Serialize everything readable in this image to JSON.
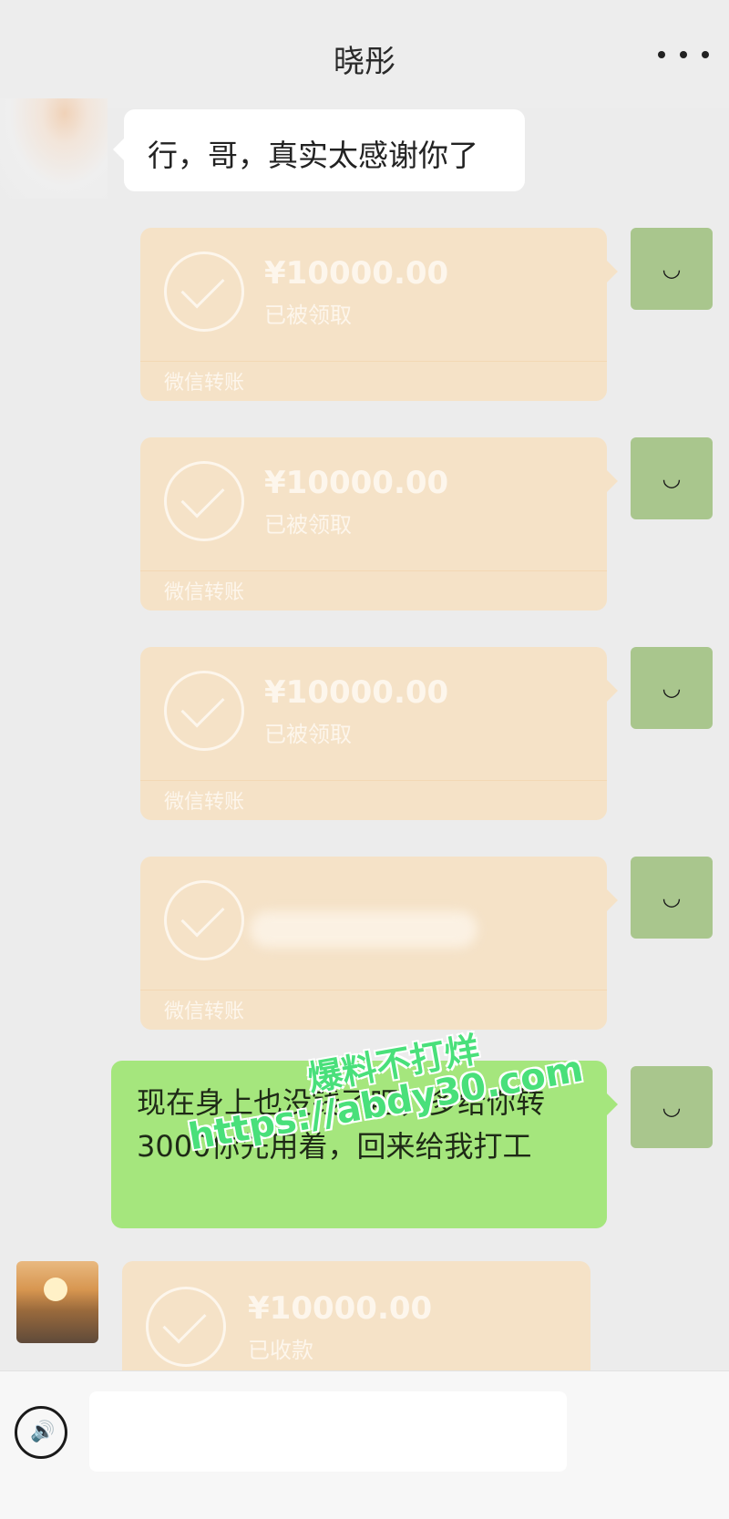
{
  "header": {
    "title": "晓彤",
    "more_icon": "ellipsis-icon"
  },
  "messages": {
    "incoming_text": "行，哥，真实太感谢你了",
    "transfers": [
      {
        "amount": "¥10000.00",
        "status": "已被领取",
        "brand": "微信转账"
      },
      {
        "amount": "¥10000.00",
        "status": "已被领取",
        "brand": "微信转账"
      },
      {
        "amount": "¥10000.00",
        "status": "已被领取",
        "brand": "微信转账"
      },
      {
        "amount": "",
        "status": "",
        "brand": "微信转账"
      }
    ],
    "outgoing_text": "现在身上也没钱了吧，多给你转3000你先用着，回来给我打工",
    "incoming_transfer": {
      "amount": "¥10000.00",
      "status": "已收款"
    }
  },
  "avatars": {
    "self_face": "◡"
  },
  "watermark": {
    "line1": "爆料不打烊",
    "line2": "https://abdy30.com"
  },
  "icons": {
    "voice": "voice-icon",
    "check": "check-circle-icon"
  },
  "colors": {
    "background": "#ececec",
    "transfer": "#f5e2c7",
    "outgoing_bubble": "#a5e67d",
    "self_avatar": "#a9c68d",
    "watermark": "#49e07a"
  }
}
